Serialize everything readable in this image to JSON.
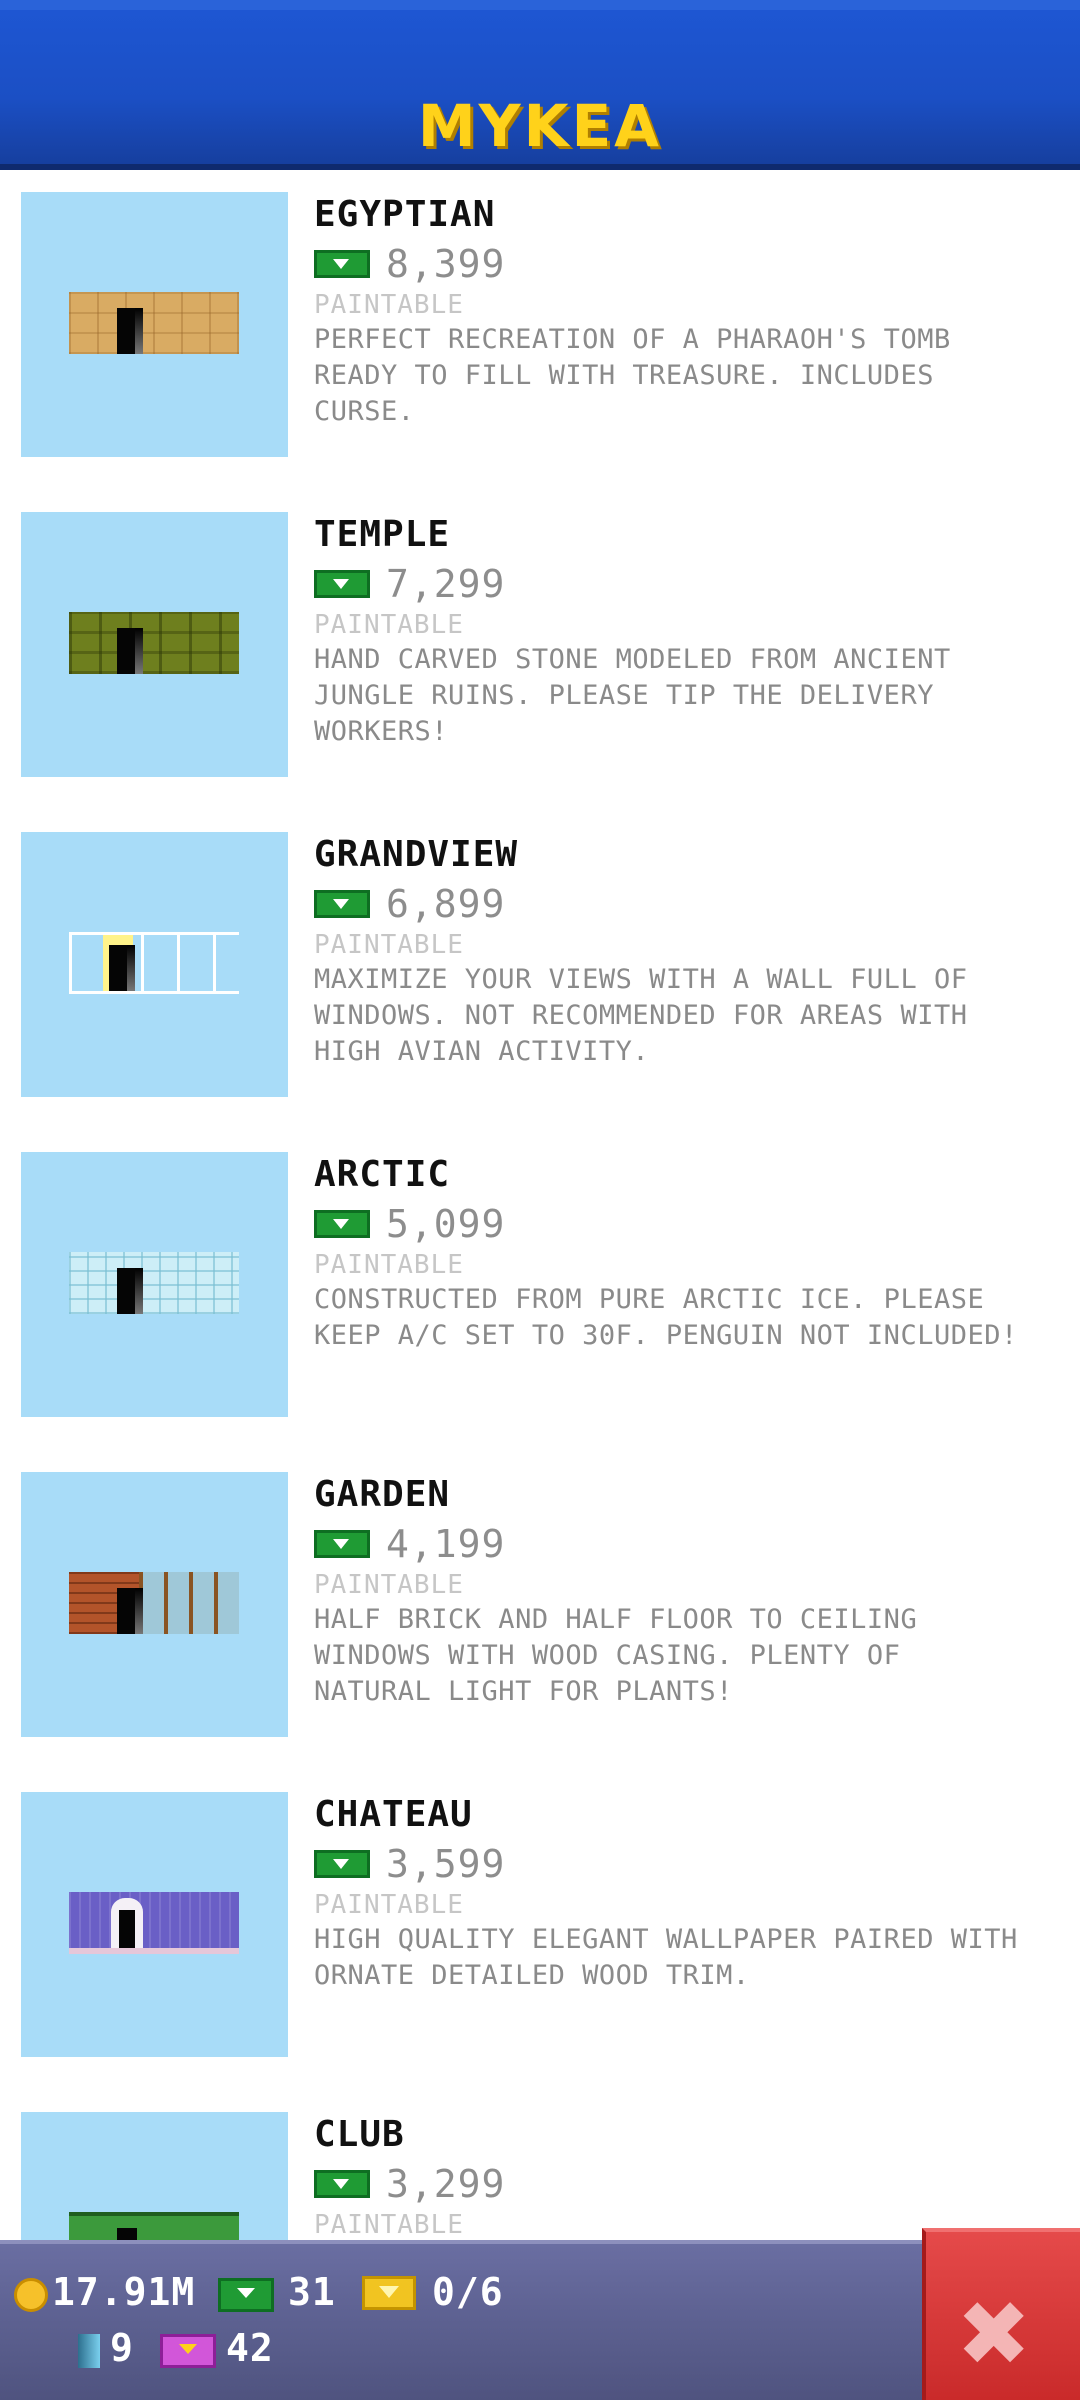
{
  "header": {
    "title": "MYKEA"
  },
  "items": [
    {
      "name": "EGYPTIAN",
      "price": "8,399",
      "tag": "PAINTABLE",
      "description": "PERFECT RECREATION OF A PHARAOH'S TOMB READY TO FILL WITH TREASURE. INCLUDES CURSE.",
      "wall_style": "egyptian-sandstone"
    },
    {
      "name": "TEMPLE",
      "price": "7,299",
      "tag": "PAINTABLE",
      "description": "HAND CARVED STONE MODELED FROM ANCIENT JUNGLE RUINS. PLEASE TIP THE DELIVERY WORKERS!",
      "wall_style": "temple-moss-stone"
    },
    {
      "name": "GRANDVIEW",
      "price": "6,899",
      "tag": "PAINTABLE",
      "description": "MAXIMIZE YOUR VIEWS WITH A WALL FULL OF WINDOWS. NOT RECOMMENDED FOR AREAS WITH HIGH AVIAN ACTIVITY.",
      "wall_style": "grandview-windows"
    },
    {
      "name": "ARCTIC",
      "price": "5,099",
      "tag": "PAINTABLE",
      "description": "CONSTRUCTED FROM PURE ARCTIC ICE. PLEASE KEEP A/C SET TO 30F. PENGUIN NOT INCLUDED!",
      "wall_style": "arctic-ice"
    },
    {
      "name": "GARDEN",
      "price": "4,199",
      "tag": "PAINTABLE",
      "description": "HALF BRICK AND HALF FLOOR TO CEILING WINDOWS WITH WOOD CASING. PLENTY OF NATURAL LIGHT FOR PLANTS!",
      "wall_style": "garden-brick-windows"
    },
    {
      "name": "CHATEAU",
      "price": "3,599",
      "tag": "PAINTABLE",
      "description": "HIGH QUALITY ELEGANT WALLPAPER PAIRED WITH ORNATE DETAILED WOOD TRIM.",
      "wall_style": "chateau-wallpaper"
    },
    {
      "name": "CLUB",
      "price": "3,299",
      "tag": "PAINTABLE",
      "description": "",
      "wall_style": "club-green"
    }
  ],
  "status_bar": {
    "coins": "17.91M",
    "bux": "31",
    "tickets": "0/6",
    "passes": "9",
    "golden_tickets": "42"
  },
  "icons": {
    "coin": "coin-icon",
    "bux": "bux-icon",
    "ticket": "ticket-icon",
    "pass": "pass-icon",
    "golden_ticket": "golden-ticket-icon",
    "close": "close-icon"
  },
  "colors": {
    "header_bg": "#1b4fc4",
    "title": "#ffd21a",
    "thumb_bg": "#a8dcf8",
    "bux_green": "#1f9b34",
    "close_red": "#d93636",
    "status_bar_bg": "#5f6391"
  }
}
